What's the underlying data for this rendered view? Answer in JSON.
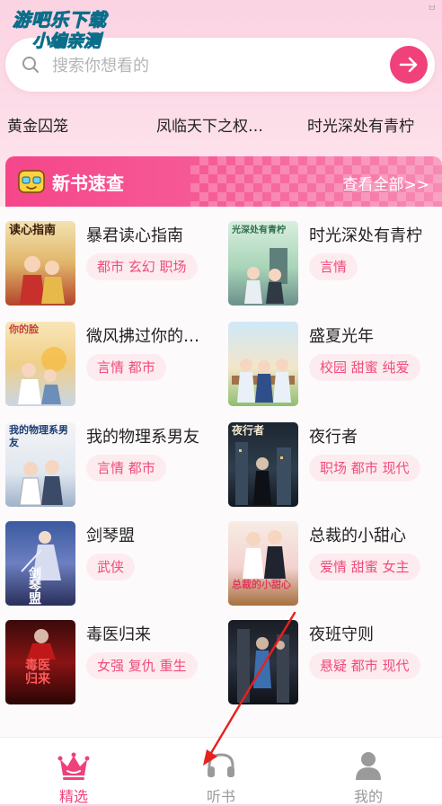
{
  "watermark": {
    "line1": "游吧乐下载",
    "line2": "小编亲测"
  },
  "corner_tag": "ㅂ",
  "search": {
    "placeholder": "搜索你想看的"
  },
  "hot_searches": [
    "黄金囚笼",
    "凤临天下之权…",
    "时光深处有青柠"
  ],
  "section": {
    "title": "新书速查",
    "more": "查看全部>>"
  },
  "books": [
    {
      "title": "暴君读心指南",
      "tags": "都市 玄幻 职场",
      "cover_text": "读心指南"
    },
    {
      "title": "时光深处有青柠",
      "tags": "言情",
      "cover_text": "光深处有青柠"
    },
    {
      "title": "微风拂过你的…",
      "tags": "言情 都市",
      "cover_text": "你的脸"
    },
    {
      "title": "盛夏光年",
      "tags": "校园 甜蜜 纯爱",
      "cover_text": ""
    },
    {
      "title": "我的物理系男友",
      "tags": "言情 都市",
      "cover_text": "我的物理系男友"
    },
    {
      "title": "夜行者",
      "tags": "职场 都市 现代",
      "cover_text": "夜行者"
    },
    {
      "title": "剑琴盟",
      "tags": "武侠",
      "cover_text": "剑琴盟"
    },
    {
      "title": "总裁的小甜心",
      "tags": "爱情 甜蜜 女主",
      "cover_text": "总裁的小甜心"
    },
    {
      "title": "毒医归来",
      "tags": "女强 复仇 重生",
      "cover_text": "毒医归来"
    },
    {
      "title": "夜班守则",
      "tags": "悬疑 都市 现代",
      "cover_text": ""
    }
  ],
  "tabs": [
    {
      "label": "精选",
      "active": true
    },
    {
      "label": "听书",
      "active": false
    },
    {
      "label": "我的",
      "active": false
    }
  ],
  "colors": {
    "accent": "#f0417a",
    "tag_bg": "#fdecef",
    "tag_text": "#ef4c7c",
    "inactive_tab": "#9a9a9a"
  }
}
